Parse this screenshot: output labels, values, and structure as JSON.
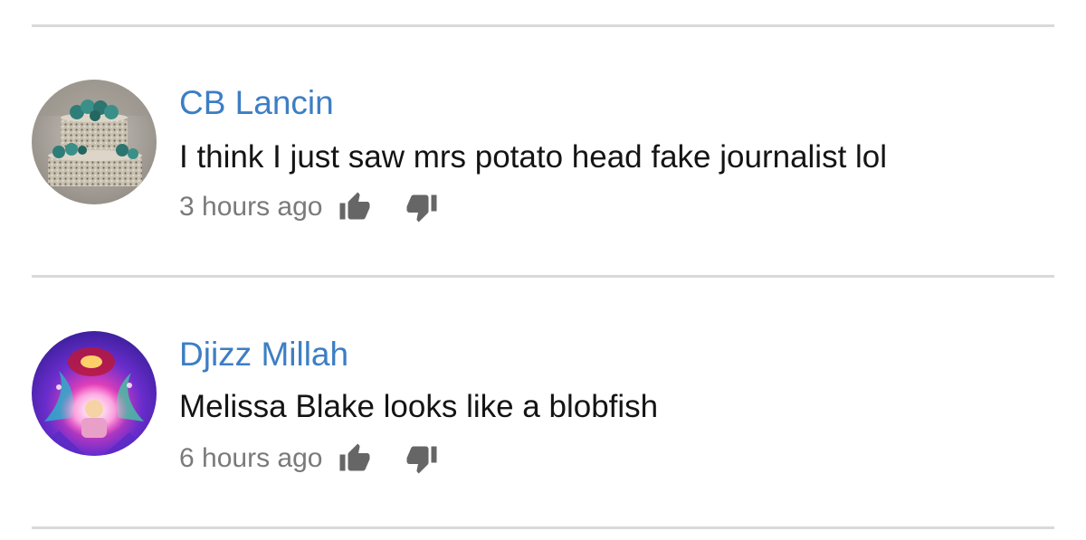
{
  "comments": [
    {
      "author": "CB Lancin",
      "text": "I think I just saw mrs potato head fake journalist lol",
      "timestamp": "3 hours ago",
      "avatar_icon": "cake-avatar",
      "like_icon": "thumbs-up-icon",
      "dislike_icon": "thumbs-down-icon"
    },
    {
      "author": "Djizz Millah",
      "text": "Melissa Blake looks like a blobfish",
      "timestamp": "6 hours ago",
      "avatar_icon": "psychedelic-avatar",
      "like_icon": "thumbs-up-icon",
      "dislike_icon": "thumbs-down-icon"
    }
  ],
  "colors": {
    "author": "#3d7ec4",
    "text": "#141414",
    "timestamp": "#7a7a7a",
    "divider": "#d9d9d9",
    "icon": "#666666"
  }
}
